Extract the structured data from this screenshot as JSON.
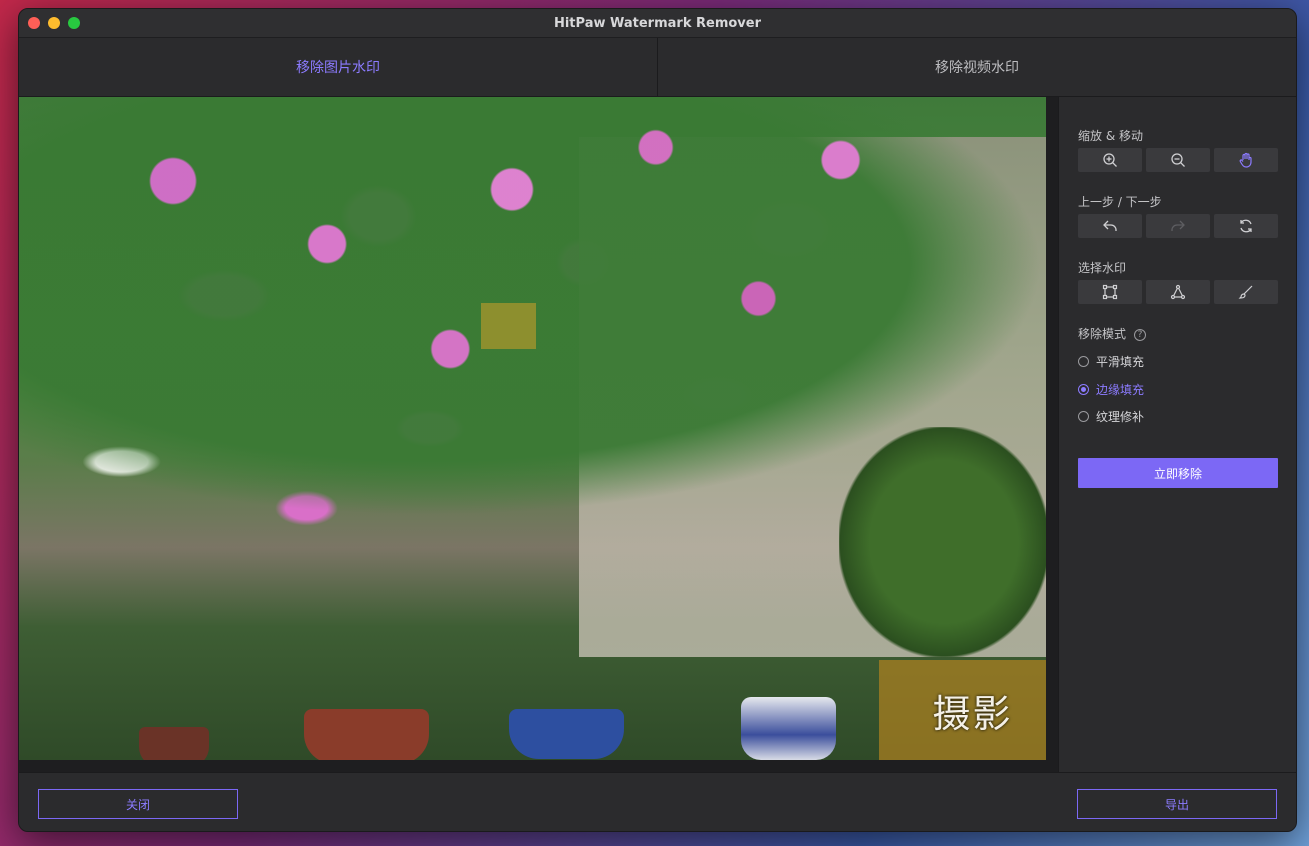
{
  "window": {
    "title": "HitPaw Watermark Remover"
  },
  "tabs": [
    {
      "label": "移除图片水印",
      "active": true
    },
    {
      "label": "移除视频水印",
      "active": false
    }
  ],
  "canvas": {
    "watermark_text": "摄影"
  },
  "panel": {
    "zoom_move": {
      "label": "缩放 & 移动",
      "buttons": [
        "zoom-in-icon",
        "zoom-out-icon",
        "hand-icon"
      ]
    },
    "undo_redo": {
      "label": "上一步 / 下一步",
      "buttons": [
        "undo-icon",
        "redo-icon",
        "reset-icon"
      ]
    },
    "select_watermark": {
      "label": "选择水印",
      "buttons": [
        "rectangle-select-icon",
        "polygon-select-icon",
        "brush-icon"
      ]
    },
    "remove_mode": {
      "label": "移除模式",
      "help": "?",
      "options": [
        {
          "label": "平滑填充",
          "checked": false
        },
        {
          "label": "边缘填充",
          "checked": true
        },
        {
          "label": "纹理修补",
          "checked": false
        }
      ]
    },
    "remove_now_label": "立即移除"
  },
  "footer": {
    "close_label": "关闭",
    "export_label": "导出"
  },
  "colors": {
    "accent": "#7c68f5",
    "accent_text": "#8c7bff",
    "panel_bg": "#2b2b2d"
  }
}
